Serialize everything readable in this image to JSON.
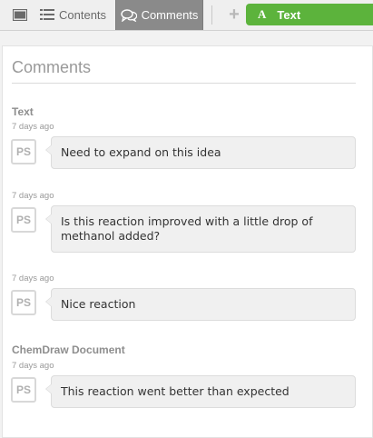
{
  "toolbar": {
    "panel_icon": "panel-icon",
    "contents_label": "Contents",
    "contents_icon": "list-icon",
    "comments_label": "Comments",
    "comments_icon": "speech-bubbles-icon",
    "plus_label": "+",
    "text_button_label": "Text",
    "text_button_icon": "A",
    "text_button_color": "#5cb33c"
  },
  "panel": {
    "title": "Comments"
  },
  "sections": [
    {
      "title": "Text",
      "comments": [
        {
          "time": "7 days ago",
          "author": "PS",
          "text": "Need to expand on this idea"
        },
        {
          "time": "7 days ago",
          "author": "PS",
          "text": "Is this reaction improved with a little drop of methanol added?"
        },
        {
          "time": "7 days ago",
          "author": "PS",
          "text": "Nice reaction"
        }
      ]
    },
    {
      "title": "ChemDraw Document",
      "comments": [
        {
          "time": "7 days ago",
          "author": "PS",
          "text": "This reaction went better than expected"
        }
      ]
    }
  ]
}
